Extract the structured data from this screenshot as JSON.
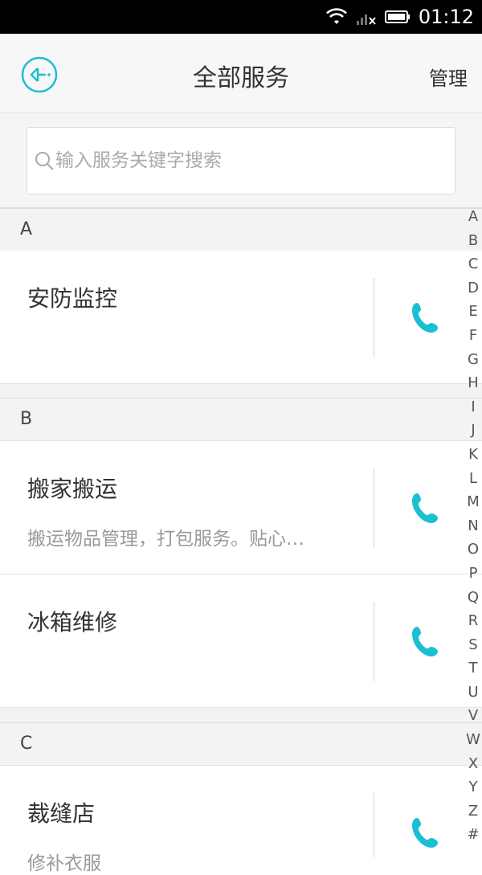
{
  "status_bar": {
    "time": "01:12"
  },
  "header": {
    "title": "全部服务",
    "manage_label": "管理"
  },
  "search": {
    "placeholder": "输入服务关键字搜索"
  },
  "sections": [
    {
      "letter": "A",
      "items": [
        {
          "name": "安防监控",
          "desc": ""
        }
      ]
    },
    {
      "letter": "B",
      "items": [
        {
          "name": "搬家搬运",
          "desc": "搬运物品管理，打包服务。贴心…"
        },
        {
          "name": "冰箱维修",
          "desc": ""
        }
      ]
    },
    {
      "letter": "C",
      "items": [
        {
          "name": "裁缝店",
          "desc": "修补衣服"
        }
      ]
    }
  ],
  "index_letters": [
    "A",
    "B",
    "C",
    "D",
    "E",
    "F",
    "G",
    "H",
    "I",
    "J",
    "K",
    "L",
    "M",
    "N",
    "O",
    "P",
    "Q",
    "R",
    "S",
    "T",
    "U",
    "V",
    "W",
    "X",
    "Y",
    "Z",
    "#"
  ],
  "colors": {
    "accent": "#1bbfd4"
  }
}
